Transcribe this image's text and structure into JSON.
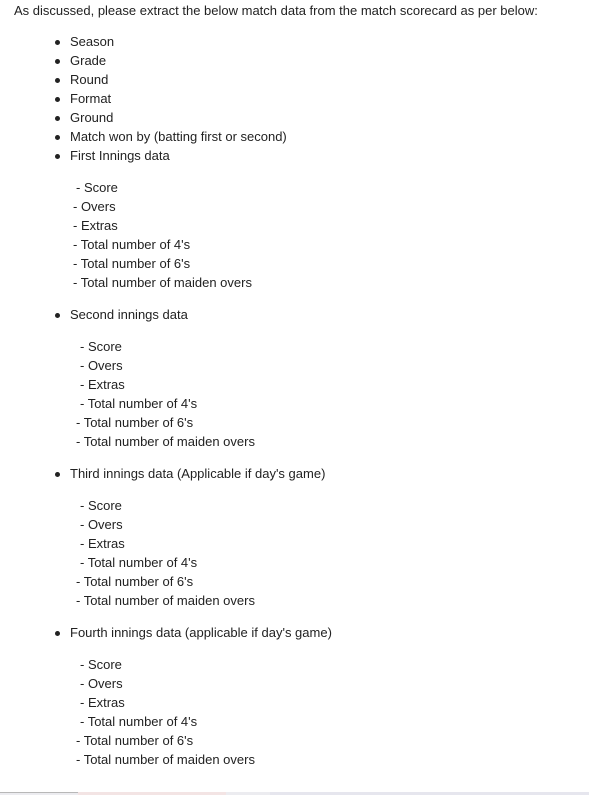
{
  "intro": "As discussed, please extract the below match data from the match scorecard as per below:",
  "items": [
    "Season",
    "Grade",
    "Round",
    "Format",
    "Ground",
    "Match won by (batting first or second)",
    "First Innings data"
  ],
  "first_innings": [
    "- Score",
    "- Overs",
    "- Extras",
    "- Total number of 4's",
    "- Total number of 6's",
    "- Total number of maiden overs"
  ],
  "second_innings_title": "Second innings data",
  "second_innings": [
    "- Score",
    "- Overs",
    "- Extras",
    "- Total number of 4's",
    "- Total number of 6's",
    "- Total number of maiden overs"
  ],
  "third_innings_title": "Third innings data (Applicable if day's game)",
  "third_innings": [
    "- Score",
    "- Overs",
    "- Extras",
    "- Total number of 4's",
    "- Total number of 6's",
    "- Total number of maiden overs"
  ],
  "fourth_innings_title": "Fourth innings data (applicable if day's game)",
  "fourth_innings": [
    "- Score",
    "- Overs",
    "- Extras",
    "- Total number of 4's",
    "- Total number of 6's",
    "- Total number of maiden overs"
  ]
}
